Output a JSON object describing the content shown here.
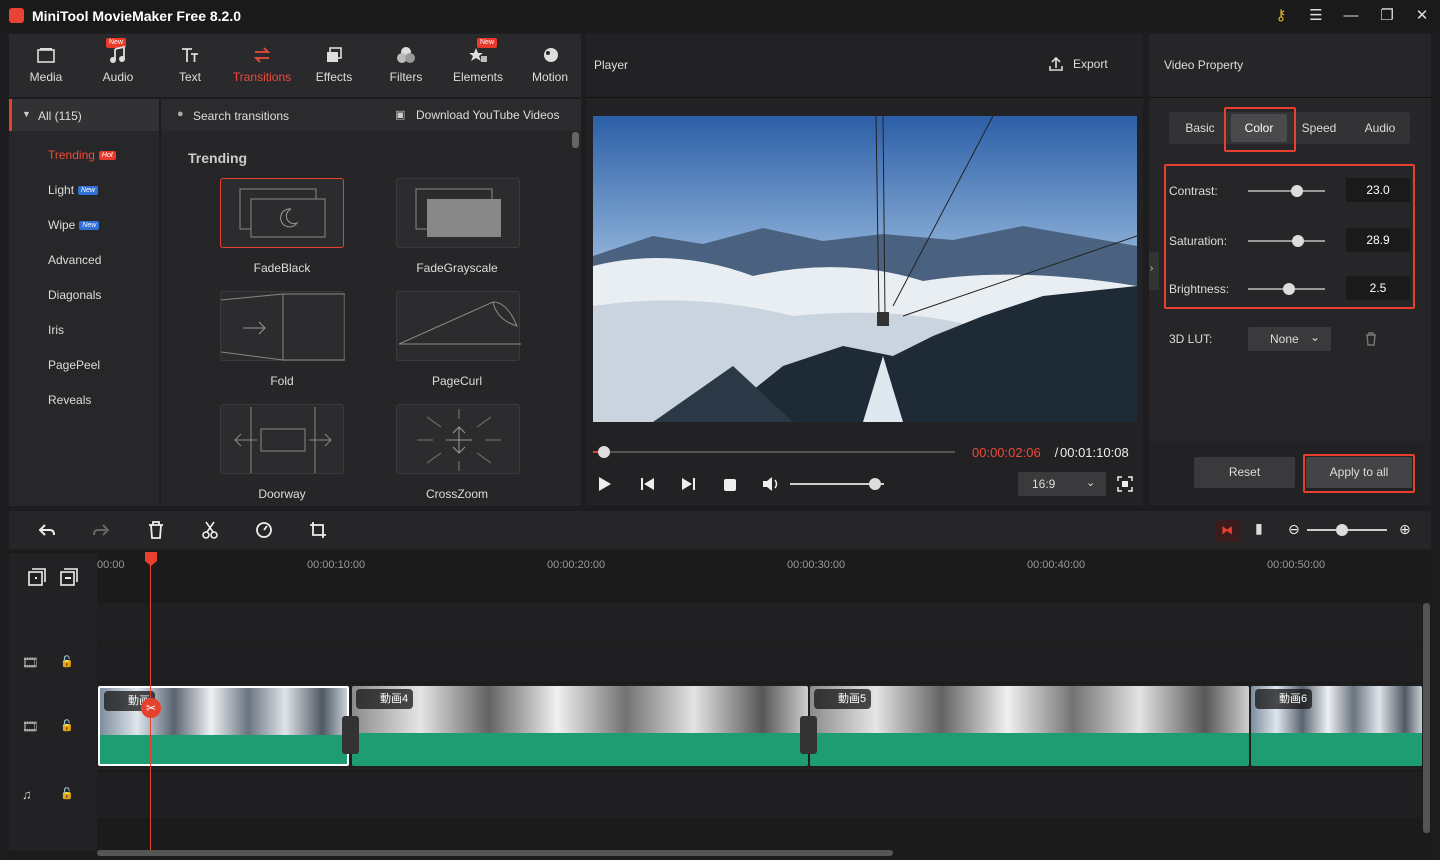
{
  "app": {
    "title": "MiniTool MovieMaker Free 8.2.0"
  },
  "colors": {
    "accent": "#e8402f",
    "audio_wave": "#1e9c72"
  },
  "toolbar": {
    "tools": [
      {
        "label": "Media",
        "icon": "media-icon",
        "new": false
      },
      {
        "label": "Audio",
        "icon": "music-note-icon",
        "new": true
      },
      {
        "label": "Text",
        "icon": "text-icon",
        "new": false
      },
      {
        "label": "Transitions",
        "icon": "transitions-icon",
        "new": false,
        "active": true
      },
      {
        "label": "Effects",
        "icon": "effects-icon",
        "new": false
      },
      {
        "label": "Filters",
        "icon": "filters-icon",
        "new": false
      },
      {
        "label": "Elements",
        "icon": "elements-icon",
        "new": true
      },
      {
        "label": "Motion",
        "icon": "motion-icon",
        "new": false
      }
    ],
    "new_label": "New"
  },
  "categories": {
    "all_label": "All (115)",
    "items": [
      {
        "label": "Trending",
        "badge": "Hot"
      },
      {
        "label": "Light",
        "badge": "New"
      },
      {
        "label": "Wipe",
        "badge": "New"
      },
      {
        "label": "Advanced"
      },
      {
        "label": "Diagonals"
      },
      {
        "label": "Iris"
      },
      {
        "label": "PagePeel"
      },
      {
        "label": "Reveals"
      }
    ]
  },
  "transitions": {
    "search_placeholder": "Search transitions",
    "download_label": "Download YouTube Videos",
    "section_title": "Trending",
    "items": [
      "FadeBlack",
      "FadeGrayscale",
      "Fold",
      "PageCurl",
      "Doorway",
      "CrossZoom"
    ]
  },
  "player": {
    "header": "Player",
    "export_label": "Export",
    "current_time": "00:00:02:06",
    "separator": " / ",
    "total_time": "00:01:10:08",
    "progress": 0.03,
    "volume": 0.9,
    "aspect_ratio": "16:9"
  },
  "property": {
    "header": "Video Property",
    "tabs": [
      "Basic",
      "Color",
      "Speed",
      "Audio"
    ],
    "active_tab": "Color",
    "contrast": {
      "label": "Contrast:",
      "value": "23.0",
      "fraction": 0.63
    },
    "saturation": {
      "label": "Saturation:",
      "value": "28.9",
      "fraction": 0.65
    },
    "brightness": {
      "label": "Brightness:",
      "value": "2.5",
      "fraction": 0.53
    },
    "lut": {
      "label": "3D LUT:",
      "value": "None"
    },
    "reset_label": "Reset",
    "apply_label": "Apply to all"
  },
  "timeline": {
    "ruler": [
      "00:00",
      "00:00:10:00",
      "00:00:20:00",
      "00:00:30:00",
      "00:00:40:00",
      "00:00:50:00"
    ],
    "clips": [
      {
        "label": "動画"
      },
      {
        "label": "動画4"
      },
      {
        "label": "動画5"
      },
      {
        "label": "動画6"
      }
    ]
  }
}
